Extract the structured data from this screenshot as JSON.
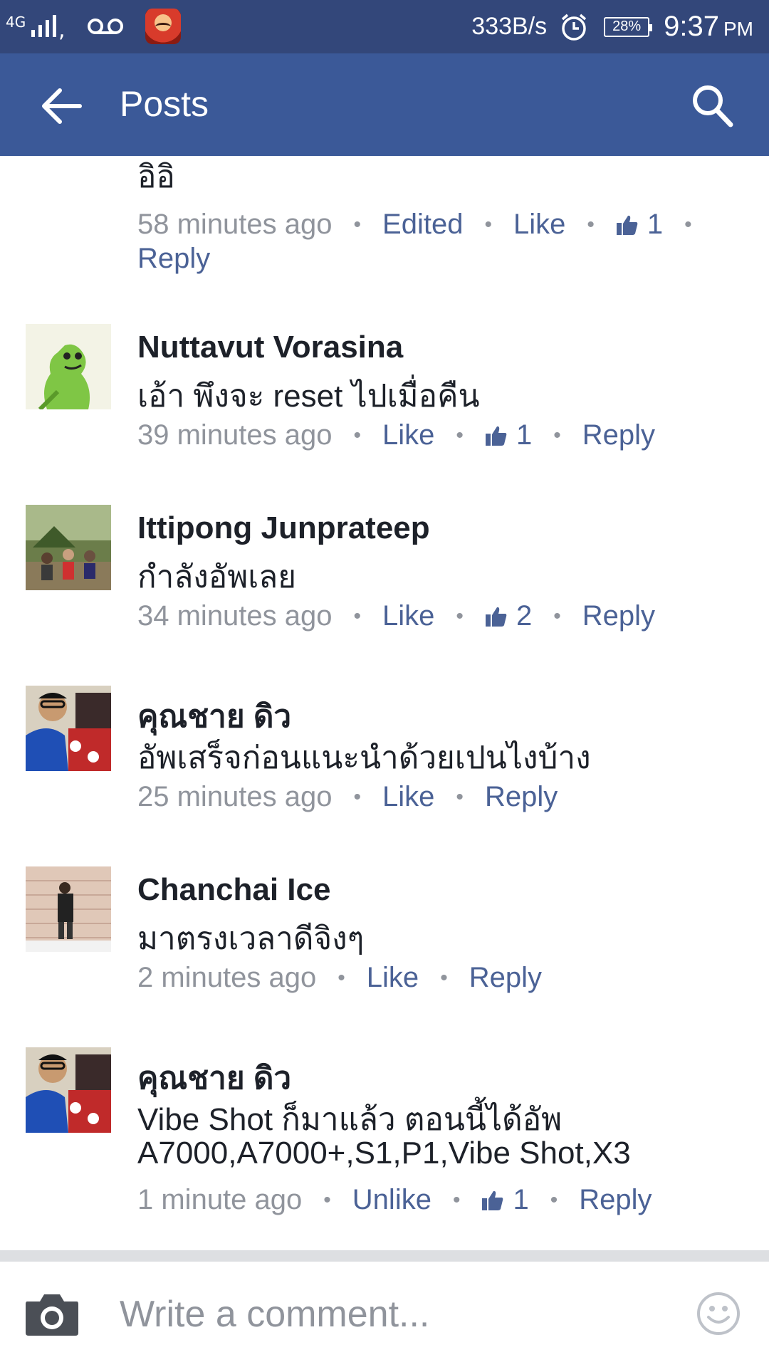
{
  "status_bar": {
    "network_type": "4G",
    "speed": "333B/s",
    "battery": "28%",
    "time": "9:37",
    "ampm": "PM"
  },
  "app_bar": {
    "title": "Posts"
  },
  "comments": [
    {
      "name": "",
      "body": [
        "อิอิ"
      ],
      "time": "58 minutes ago",
      "edited": "Edited",
      "like_label": "Like",
      "like_count": "1",
      "reply_label": "Reply"
    },
    {
      "name": "Nuttavut Vorasina",
      "avatar_icon": "green-frog-avatar",
      "body": [
        "เอ้า พึงจะ reset ไปเมื่อคืน"
      ],
      "time": "39 minutes ago",
      "like_label": "Like",
      "like_count": "1",
      "reply_label": "Reply"
    },
    {
      "name": "Ittipong Junprateep",
      "avatar_icon": "group-photo-avatar",
      "body": [
        "กำลังอัพเลย"
      ],
      "time": "34 minutes ago",
      "like_label": "Like",
      "like_count": "2",
      "reply_label": "Reply"
    },
    {
      "name": "คุณชาย ดิว",
      "avatar_icon": "selfie-blue-shirt-avatar",
      "body": [
        "อัพเสร็จก่อนแนะนำด้วยเปนไงบ้าง"
      ],
      "time": "25 minutes ago",
      "like_label": "Like",
      "reply_label": "Reply"
    },
    {
      "name": "Chanchai Ice",
      "avatar_icon": "person-brick-wall-avatar",
      "body": [
        "มาตรงเวลาดีจิงๆ"
      ],
      "time": "2 minutes ago",
      "like_label": "Like",
      "reply_label": "Reply"
    },
    {
      "name": "คุณชาย ดิว",
      "avatar_icon": "selfie-blue-shirt-avatar",
      "body": [
        "Vibe Shot ก็มาแล้ว ตอนนี้ได้อัพ",
        "A7000,A7000+,S1,P1,Vibe Shot,X3"
      ],
      "time": "1 minute ago",
      "like_label": "Unlike",
      "like_count": "1",
      "reply_label": "Reply"
    }
  ],
  "composer": {
    "placeholder": "Write a comment..."
  },
  "icons": {
    "back": "arrow-left-icon",
    "search": "search-icon",
    "camera": "camera-icon",
    "emoji": "smiley-icon",
    "like": "thumbs-up-icon",
    "alarm": "alarm-clock-icon",
    "voicemail": "voicemail-icon"
  },
  "colors": {
    "status_bar": "#33477a",
    "app_bar": "#3b5998",
    "link": "#4b6296",
    "meta_gray": "#90949c",
    "divider": "#dddfe2"
  }
}
